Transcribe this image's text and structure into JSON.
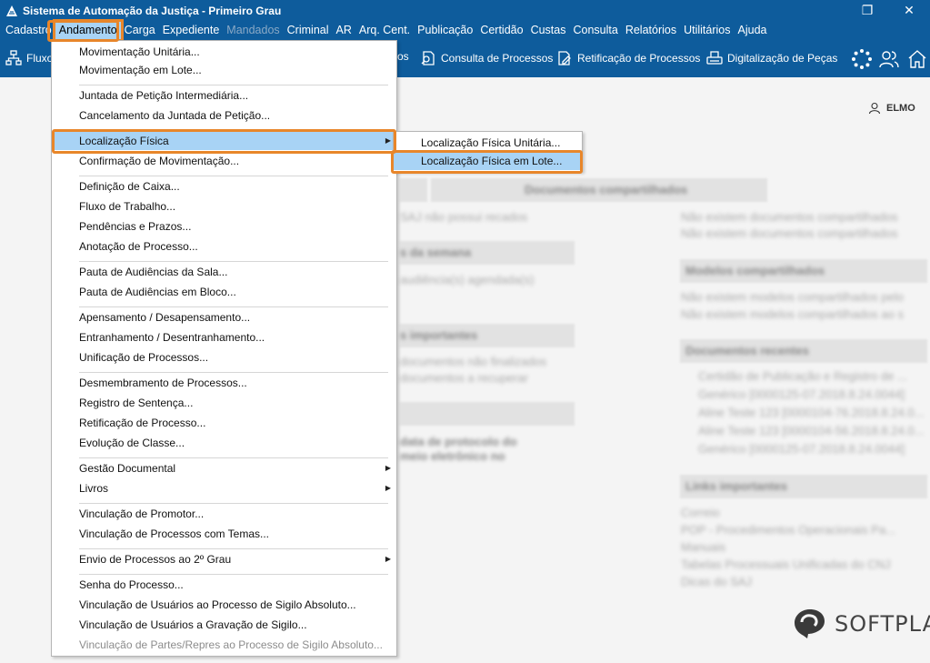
{
  "window": {
    "title": "Sistema de Automação da Justiça - Primeiro Grau",
    "restore_glyph": "❐",
    "close_glyph": "✕"
  },
  "menubar": [
    {
      "label": "Cadastro",
      "state": "normal"
    },
    {
      "label": "Andamento",
      "state": "active"
    },
    {
      "label": "Carga",
      "state": "normal"
    },
    {
      "label": "Expediente",
      "state": "normal"
    },
    {
      "label": "Mandados",
      "state": "disabled"
    },
    {
      "label": "Criminal",
      "state": "normal"
    },
    {
      "label": "AR",
      "state": "normal"
    },
    {
      "label": "Arq. Cent.",
      "state": "normal"
    },
    {
      "label": "Publicação",
      "state": "normal"
    },
    {
      "label": "Certidão",
      "state": "normal"
    },
    {
      "label": "Custas",
      "state": "normal"
    },
    {
      "label": "Consulta",
      "state": "normal"
    },
    {
      "label": "Relatórios",
      "state": "normal"
    },
    {
      "label": "Utilitários",
      "state": "normal"
    },
    {
      "label": "Ajuda",
      "state": "normal"
    }
  ],
  "toolbar": {
    "fluxo_label": "Fluxo",
    "partial_label": "os",
    "consulta_label": "Consulta de Processos",
    "retificacao_label": "Retificação de Processos",
    "digitalizacao_label": "Digitalização de Peças"
  },
  "user": {
    "name": "ELMO"
  },
  "dropdown": {
    "items": [
      {
        "label": "Movimentação Unitária...",
        "mn": "M",
        "arrow": false,
        "state": "normal"
      },
      {
        "label": "Movimentação em Lote...",
        "mn": "",
        "arrow": false,
        "state": "normal"
      },
      {
        "label": "Juntada de Petição Intermediária...",
        "mn": "J",
        "arrow": false,
        "state": "normal"
      },
      {
        "label": "Cancelamento da Juntada de Petição...",
        "mn": "",
        "arrow": false,
        "state": "normal"
      },
      {
        "label": "Localização Física",
        "mn": "",
        "arrow": true,
        "state": "highlight"
      },
      {
        "label": "Confirmação de Movimentação...",
        "mn": "",
        "arrow": false,
        "state": "normal"
      },
      {
        "label": "Definição de Caixa...",
        "mn": "D",
        "arrow": false,
        "state": "normal"
      },
      {
        "label": "Fluxo de Trabalho...",
        "mn": "F",
        "arrow": false,
        "state": "normal"
      },
      {
        "label": "Pendências e Prazos...",
        "mn": "P",
        "arrow": false,
        "state": "normal"
      },
      {
        "label": "Anotação de Processo...",
        "mn": "",
        "arrow": false,
        "state": "normal"
      },
      {
        "label": "Pauta de Audiências da Sala...",
        "mn": "",
        "arrow": false,
        "state": "normal"
      },
      {
        "label": "Pauta de Audiências em Bloco...",
        "mn": "",
        "arrow": false,
        "state": "normal"
      },
      {
        "label": "Apensamento / Desapensamento...",
        "mn": "A",
        "arrow": false,
        "state": "normal"
      },
      {
        "label": "Entranhamento / Desentranhamento...",
        "mn": "",
        "arrow": false,
        "state": "normal"
      },
      {
        "label": "Unificação de Processos...",
        "mn": "U",
        "arrow": false,
        "state": "normal"
      },
      {
        "label": "Desmembramento de Processos...",
        "mn": "",
        "arrow": false,
        "state": "normal"
      },
      {
        "label": "Registro de Sentença...",
        "mn": "R",
        "arrow": false,
        "state": "normal"
      },
      {
        "label": "Retificação de Processo...",
        "mn": "",
        "arrow": false,
        "state": "normal"
      },
      {
        "label": "Evolução de Classe...",
        "mn": "E",
        "arrow": false,
        "state": "normal"
      },
      {
        "label": "Gestão Documental",
        "mn": "",
        "arrow": true,
        "state": "normal"
      },
      {
        "label": "Livros",
        "mn": "",
        "arrow": true,
        "state": "normal"
      },
      {
        "label": "Vinculação de Promotor...",
        "mn": "V",
        "arrow": false,
        "state": "normal"
      },
      {
        "label": "Vinculação de Processos com Temas...",
        "mn": "",
        "arrow": false,
        "state": "normal"
      },
      {
        "label": "Envio de Processos ao 2º Grau",
        "mn": "",
        "arrow": true,
        "state": "normal"
      },
      {
        "label": "Senha do Processo...",
        "mn": "S",
        "arrow": false,
        "state": "normal"
      },
      {
        "label": "Vinculação de Usuários ao Processo de Sigilo Absoluto...",
        "mn": "",
        "arrow": false,
        "state": "normal"
      },
      {
        "label": "Vinculação de Usuários a Gravação de Sigilo...",
        "mn": "",
        "arrow": false,
        "state": "normal"
      },
      {
        "label": "Vinculação de Partes/Repres ao Processo de Sigilo Absoluto...",
        "mn": "",
        "arrow": false,
        "state": "disabled"
      }
    ]
  },
  "submenu": {
    "items": [
      {
        "label": "Localização Física Unitária...",
        "state": "normal"
      },
      {
        "label": "Localização Física em Lote...",
        "state": "highlight"
      }
    ]
  },
  "background": {
    "panel_titles": [
      "Documentos compartilhados",
      "Modelos compartilhados",
      "Documentos recentes",
      "Links importantes"
    ],
    "left_fragments": [
      "SAJ não possui recados",
      "s da semana",
      "audiência(s) agendada(s)",
      "s importantes",
      "documentos não finalizados",
      "documentos a recuperar",
      "data de protocolo do",
      "meio eletrônico no"
    ],
    "right_lines": [
      "Não existem documentos compartilhados",
      "Não existem documentos compartilhados",
      "Não existem modelos compartilhados pelo",
      "Não existem modelos compartilhados ao s",
      "Certidão de Publicação e Registro de ...",
      "Genérico [0000125-07.2018.8.24.0044]",
      "Aline Teste 123 [0000104-76.2018.8.24.0...",
      "Aline Teste 123 [0000104-56.2018.8.24.0...",
      "Genérico [0000125-07.2018.8.24.0044]",
      "Correio",
      "POP - Procedimentos Operacionais Pa...",
      "Manuais",
      "Tabelas Processuais Unificadas do CNJ",
      "Dicas do SAJ"
    ]
  },
  "brand": {
    "logo_text": "SOFTPLAN"
  },
  "colors": {
    "bar": "#0e5c9c",
    "highlight": "#a8d3f5",
    "callout": "#e8862a"
  }
}
